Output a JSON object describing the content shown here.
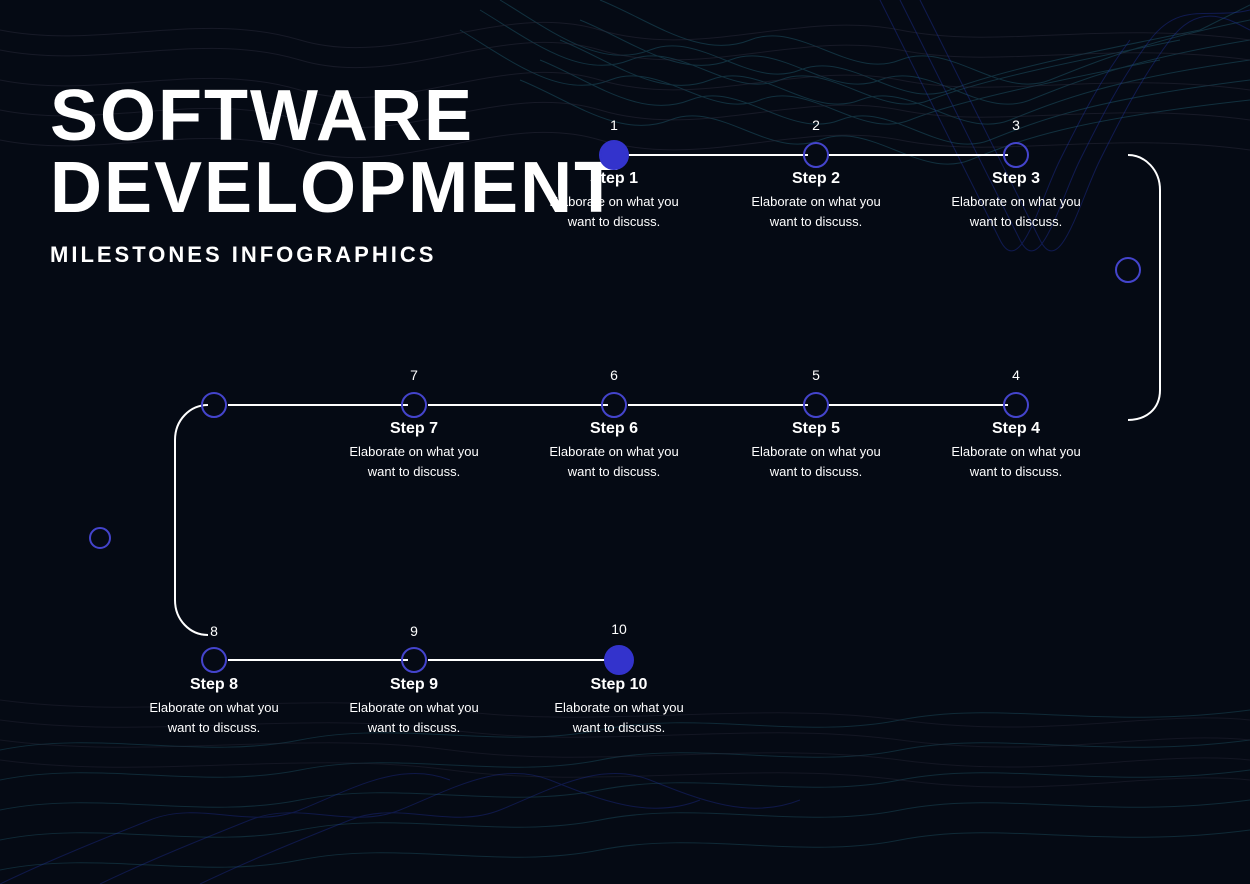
{
  "title": {
    "main_line1": "SOFTWARE",
    "main_line2": "DEVELOPMENT",
    "subtitle": "MILESTONES INFOGRAPHICS"
  },
  "steps": [
    {
      "id": 1,
      "label": "Step  1",
      "desc": "Elaborate on what you want to discuss.",
      "filled": true
    },
    {
      "id": 2,
      "label": "Step  2",
      "desc": "Elaborate on what you want to discuss.",
      "filled": false
    },
    {
      "id": 3,
      "label": "Step  3",
      "desc": "Elaborate on what you want to discuss.",
      "filled": false
    },
    {
      "id": 4,
      "label": "Step  4",
      "desc": "Elaborate on what you want to discuss.",
      "filled": false
    },
    {
      "id": 5,
      "label": "Step  5",
      "desc": "Elaborate on what you want to discuss.",
      "filled": false
    },
    {
      "id": 6,
      "label": "Step  6",
      "desc": "Elaborate on what you want to discuss.",
      "filled": false
    },
    {
      "id": 7,
      "label": "Step  7",
      "desc": "Elaborate on what you want to discuss.",
      "filled": false
    },
    {
      "id": 8,
      "label": "Step  8",
      "desc": "Elaborate on what you want to discuss.",
      "filled": false
    },
    {
      "id": 9,
      "label": "Step  9",
      "desc": "Elaborate on what you want to discuss.",
      "filled": false
    },
    {
      "id": 10,
      "label": "Step  10",
      "desc": "Elaborate on what you want to discuss.",
      "filled": true
    }
  ]
}
